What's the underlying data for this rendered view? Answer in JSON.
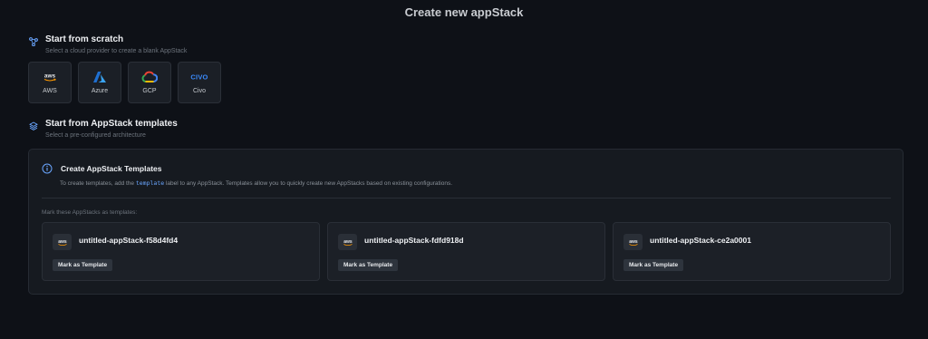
{
  "page_title": "Create new appStack",
  "scratch": {
    "title": "Start from scratch",
    "subtitle": "Select a cloud provider to create a blank AppStack",
    "icon": "nodes-icon"
  },
  "providers": [
    {
      "label": "AWS",
      "icon": "aws-logo-icon"
    },
    {
      "label": "Azure",
      "icon": "azure-logo-icon"
    },
    {
      "label": "GCP",
      "icon": "gcp-logo-icon"
    },
    {
      "label": "Civo",
      "icon": "civo-logo-icon"
    }
  ],
  "templates": {
    "title": "Start from AppStack templates",
    "subtitle": "Select a pre-configured architecture",
    "icon": "layers-icon"
  },
  "info": {
    "title": "Create AppStack Templates",
    "desc_before": "To create templates, add the",
    "desc_code": "template",
    "desc_after": "label to any AppStack. Templates allow you to quickly create new AppStacks based on existing configurations.",
    "mark_label": "Mark these AppStacks as templates:"
  },
  "cards": [
    {
      "name": "untitled-appStack-f58d4fd4",
      "button": "Mark as Template",
      "provider": "aws"
    },
    {
      "name": "untitled-appStack-fdfd918d",
      "button": "Mark as Template",
      "provider": "aws"
    },
    {
      "name": "untitled-appStack-ce2a0001",
      "button": "Mark as Template",
      "provider": "aws"
    }
  ],
  "colors": {
    "background": "#0e1117",
    "panel": "#161a20",
    "accent": "#6aa6ff",
    "azure": "#2b8be6",
    "aws_orange": "#ff9900"
  }
}
